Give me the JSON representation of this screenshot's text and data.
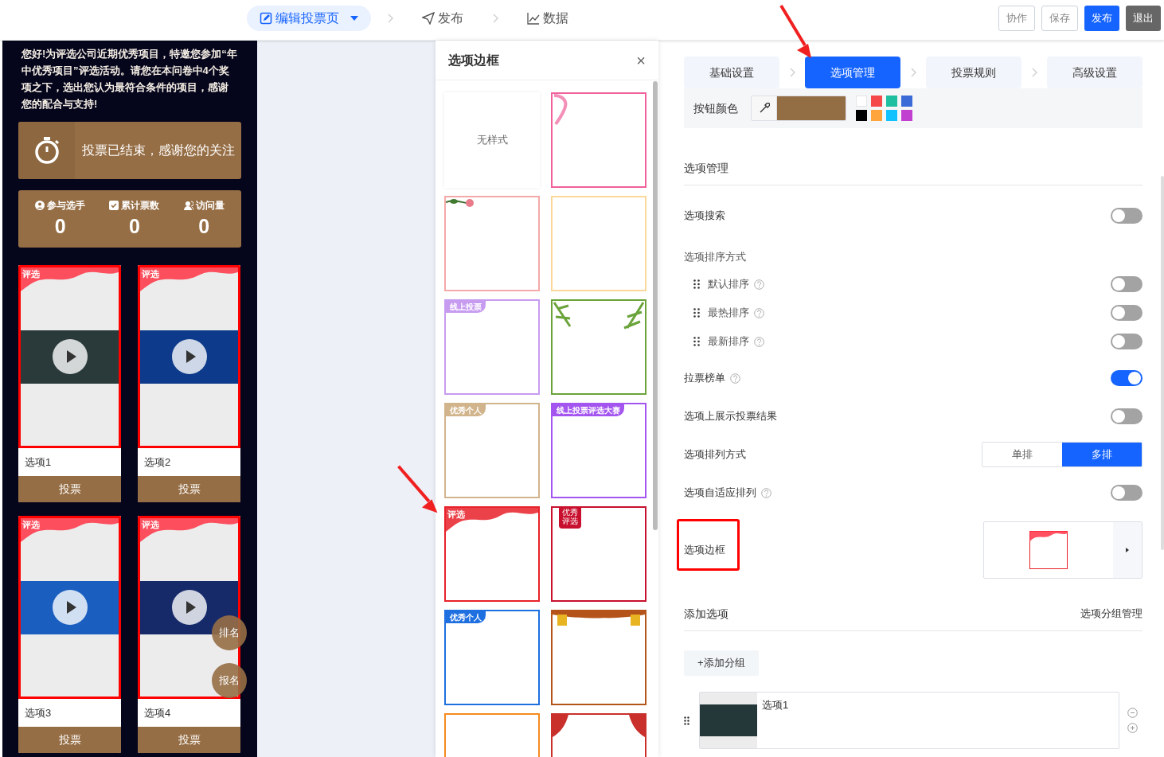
{
  "top_nav": {
    "steps": [
      {
        "label": "编辑投票页",
        "selected": true,
        "kind": "edit"
      },
      {
        "label": "发布",
        "selected": false,
        "kind": "send"
      },
      {
        "label": "数据",
        "selected": false,
        "kind": "chart"
      }
    ],
    "actions": [
      {
        "label": "协作",
        "kind": "outline"
      },
      {
        "label": "保存",
        "kind": "outline"
      },
      {
        "label": "发布",
        "kind": "primary"
      },
      {
        "label": "退出",
        "kind": "dark"
      }
    ]
  },
  "preview": {
    "intro": "您好!为评选公司近期优秀项目，特邀您参加“年中优秀项目”评选活动。请您在本问卷中4个奖项之下，选出您认为最符合条件的项目，感谢您的配合与支持!",
    "banner": "投票已结束，感谢您的关注",
    "stats": [
      {
        "label": "参与选手",
        "value": "0",
        "kind": "user"
      },
      {
        "label": "累计票数",
        "value": "0",
        "kind": "check"
      },
      {
        "label": "访问量",
        "value": "0",
        "kind": "users"
      }
    ],
    "cards": [
      {
        "badge": "评选",
        "name": "选项1",
        "vote": "投票"
      },
      {
        "badge": "评选",
        "name": "选项2",
        "vote": "投票"
      },
      {
        "badge": "评选",
        "name": "选项3",
        "vote": "投票"
      },
      {
        "badge": "评选",
        "name": "选项4",
        "vote": "投票"
      }
    ],
    "floating": [
      "排名",
      "报名"
    ]
  },
  "drawer": {
    "title": "选项边框",
    "close": "×",
    "frames": [
      {
        "kind": "none",
        "label": "无样式"
      },
      {
        "kind": "ribbon",
        "color": "#f0609a"
      },
      {
        "kind": "flowers",
        "color": "#f4a9a9"
      },
      {
        "kind": "plain",
        "color": "#fbd89a"
      },
      {
        "kind": "tag",
        "color": "#c79cf0",
        "label": "线上投票"
      },
      {
        "kind": "leaves",
        "color": "#6aa33a"
      },
      {
        "kind": "tag",
        "color": "#d2b48c",
        "label": "优秀个人"
      },
      {
        "kind": "tag",
        "color": "#a455f0",
        "label": "线上投票评选大赛"
      },
      {
        "kind": "wave",
        "color": "#e8212a",
        "label": "评选"
      },
      {
        "kind": "banner",
        "color": "#c8102e",
        "label": "优秀评选"
      },
      {
        "kind": "tag",
        "color": "#1e6fe0",
        "label": "优秀个人"
      },
      {
        "kind": "lanterns",
        "color": "#b5541a"
      },
      {
        "kind": "plain",
        "color": "#f58a1f"
      },
      {
        "kind": "curtain",
        "color": "#c9302c"
      }
    ]
  },
  "settings": {
    "tabs": [
      {
        "label": "基础设置",
        "selected": false
      },
      {
        "label": "选项管理",
        "selected": true
      },
      {
        "label": "投票规则",
        "selected": false
      },
      {
        "label": "高级设置",
        "selected": false
      }
    ],
    "button_color": {
      "label": "按钮颜色",
      "color": "#936d43",
      "palette": [
        {
          "color": "#ffffff"
        },
        {
          "color": "#f5484a"
        },
        {
          "color": "#1ebfa1"
        },
        {
          "color": "#3b6bd6"
        },
        {
          "color": "#000000"
        },
        {
          "color": "#ffa53b"
        },
        {
          "color": "#12c2ff"
        },
        {
          "color": "#c240d0"
        }
      ]
    },
    "section": "选项管理",
    "rows": [
      {
        "kind": "toggle",
        "label": "选项搜索",
        "help": false,
        "on": false
      },
      {
        "kind": "group",
        "label": "选项排序方式",
        "children": [
          {
            "label": "默认排序",
            "on": false
          },
          {
            "label": "最热排序",
            "on": false
          },
          {
            "label": "最新排序",
            "on": false
          }
        ]
      },
      {
        "kind": "toggle",
        "label": "拉票榜单",
        "help": true,
        "on": true
      },
      {
        "kind": "toggle",
        "label": "选项上展示投票结果",
        "help": false,
        "on": false
      },
      {
        "kind": "segmented",
        "label": "选项排列方式",
        "options": [
          {
            "label": "单排",
            "selected": false
          },
          {
            "label": "多排",
            "selected": true
          }
        ]
      },
      {
        "kind": "toggle",
        "label": "选项自适应排列",
        "help": true,
        "on": false
      },
      {
        "kind": "frame",
        "label": "选项边框",
        "highlighted": true
      }
    ],
    "add_section": {
      "title": "添加选项",
      "link": "选项分组管理",
      "add_group": "+添加分组",
      "items": [
        {
          "name": "选项1"
        }
      ]
    }
  }
}
